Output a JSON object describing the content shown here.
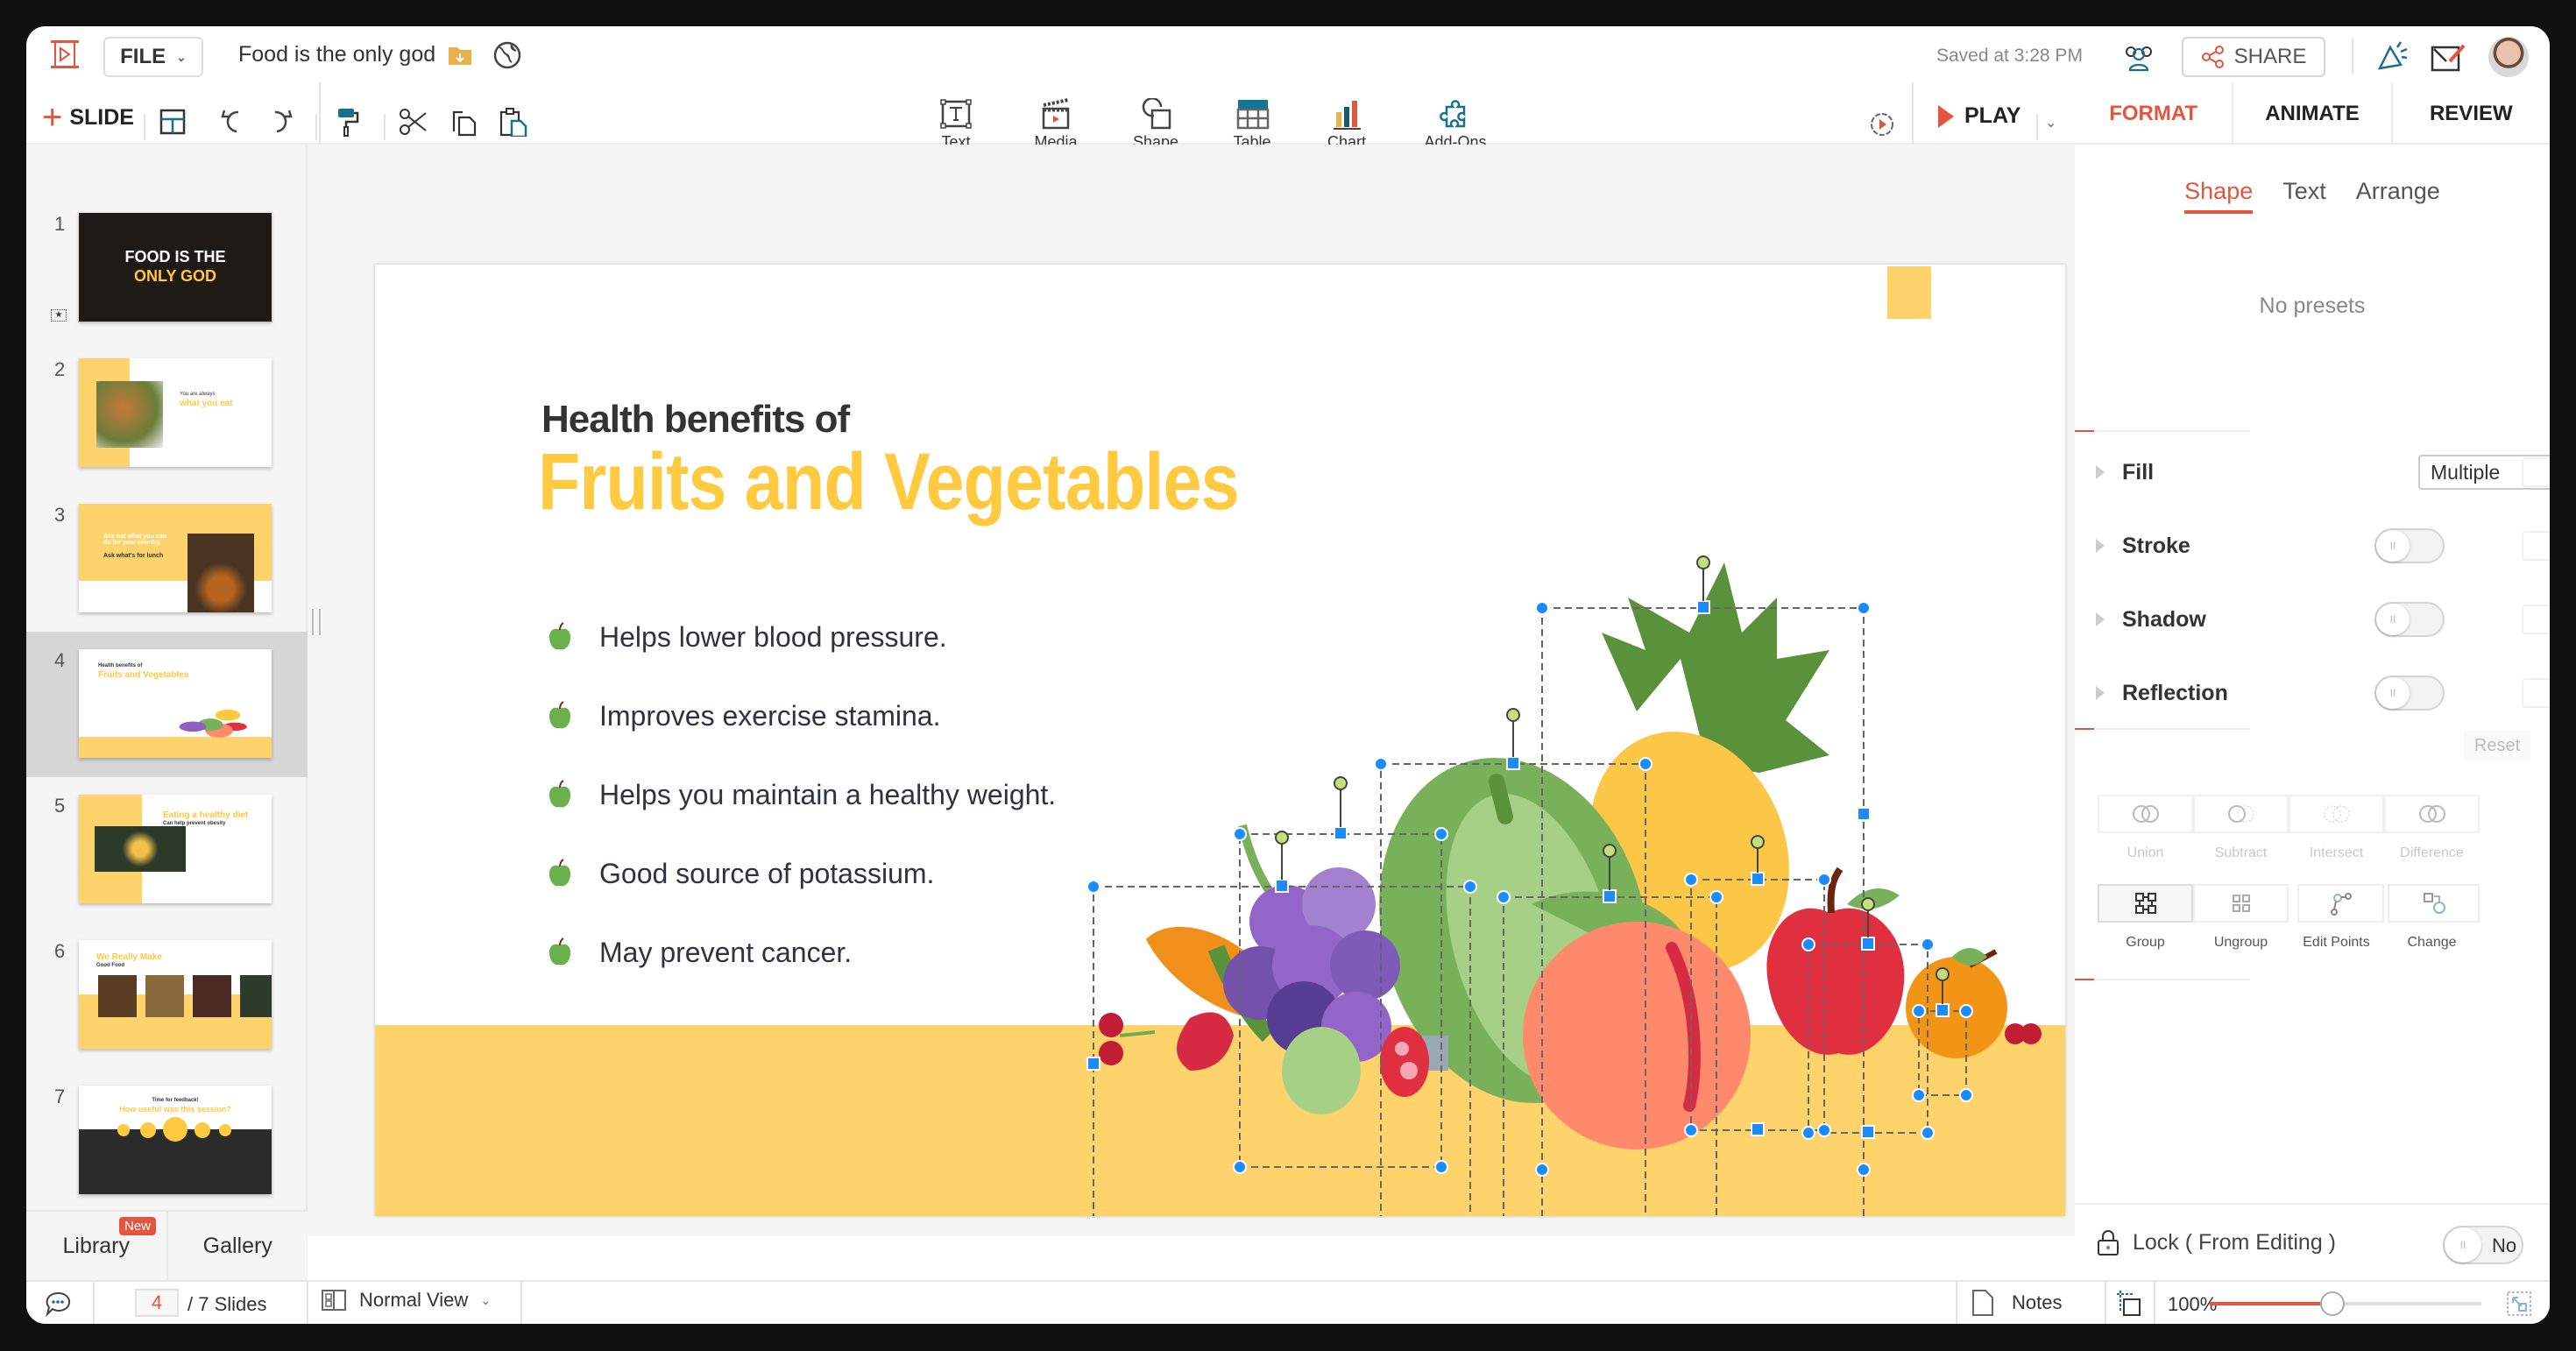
{
  "app": {
    "file_menu_label": "FILE",
    "document_title": "Food is the only god",
    "saved_status": "Saved at 3:28 PM",
    "share_label": "SHARE",
    "add_slide_label": "SLIDE",
    "play_label": "PLAY"
  },
  "insert_toolbar": [
    {
      "label": "Text",
      "icon": "text-box-icon"
    },
    {
      "label": "Media",
      "icon": "clapperboard-icon"
    },
    {
      "label": "Shape",
      "icon": "shape-icon"
    },
    {
      "label": "Table",
      "icon": "table-icon"
    },
    {
      "label": "Chart",
      "icon": "bar-chart-icon"
    },
    {
      "label": "Add-Ons",
      "icon": "puzzle-icon"
    }
  ],
  "panel_tabs": [
    {
      "label": "FORMAT",
      "active": true
    },
    {
      "label": "ANIMATE",
      "active": false
    },
    {
      "label": "REVIEW",
      "active": false
    }
  ],
  "slides_panel": {
    "selected": 4,
    "thumbnails": [
      {
        "number": "1",
        "title_line1": "FOOD IS THE",
        "title_line2": "ONLY GOD"
      },
      {
        "number": "2",
        "title_line1": "You are always",
        "title_line2": "what you eat"
      },
      {
        "number": "3",
        "title_line1": "Ask not what you can do for your country.",
        "title_line2": "Ask what's for lunch"
      },
      {
        "number": "4",
        "title_line1": "Health benefits of",
        "title_line2": "Fruits and Vegetables"
      },
      {
        "number": "5",
        "title_line1": "Eating a healthy diet",
        "title_line2": "Can help prevent obesity"
      },
      {
        "number": "6",
        "title_line1": "We Really Make",
        "title_line2": "Good Food"
      },
      {
        "number": "7",
        "title_line1": "Time for feedback!",
        "title_line2": "How useful was this session?"
      }
    ],
    "library_label": "Library",
    "library_badge": "New",
    "gallery_label": "Gallery"
  },
  "slide": {
    "subtitle": "Health benefits of",
    "title": "Fruits and Vegetables",
    "bullets": [
      "Helps lower blood pressure.",
      "Improves exercise stamina.",
      "Helps you maintain a healthy weight.",
      "Good source of potassium.",
      "May prevent cancer."
    ],
    "colors": {
      "accent_yellow": "#ffc940",
      "band_yellow": "#ffd36b",
      "bullet_green": "#6ab04c"
    }
  },
  "format_panel": {
    "subtabs": [
      {
        "label": "Shape",
        "active": true
      },
      {
        "label": "Text",
        "active": false
      },
      {
        "label": "Arrange",
        "active": false
      }
    ],
    "presets_text": "No presets",
    "fill_label": "Fill",
    "fill_value": "Multiple",
    "stroke_label": "Stroke",
    "stroke_on": false,
    "shadow_label": "Shadow",
    "shadow_on": false,
    "reflection_label": "Reflection",
    "reflection_on": false,
    "reset_label": "Reset",
    "boolean_ops": [
      "Union",
      "Subtract",
      "Intersect",
      "Difference"
    ],
    "group_ops": [
      "Group",
      "Ungroup",
      "Edit Points",
      "Change"
    ],
    "lock_label": "Lock ( From Editing )",
    "lock_value": "No"
  },
  "status_bar": {
    "current_slide": "4",
    "total_slides": "/ 7 Slides",
    "view_label": "Normal View",
    "notes_label": "Notes",
    "zoom_label": "100%",
    "zoom_slider_fraction": 0.45
  }
}
